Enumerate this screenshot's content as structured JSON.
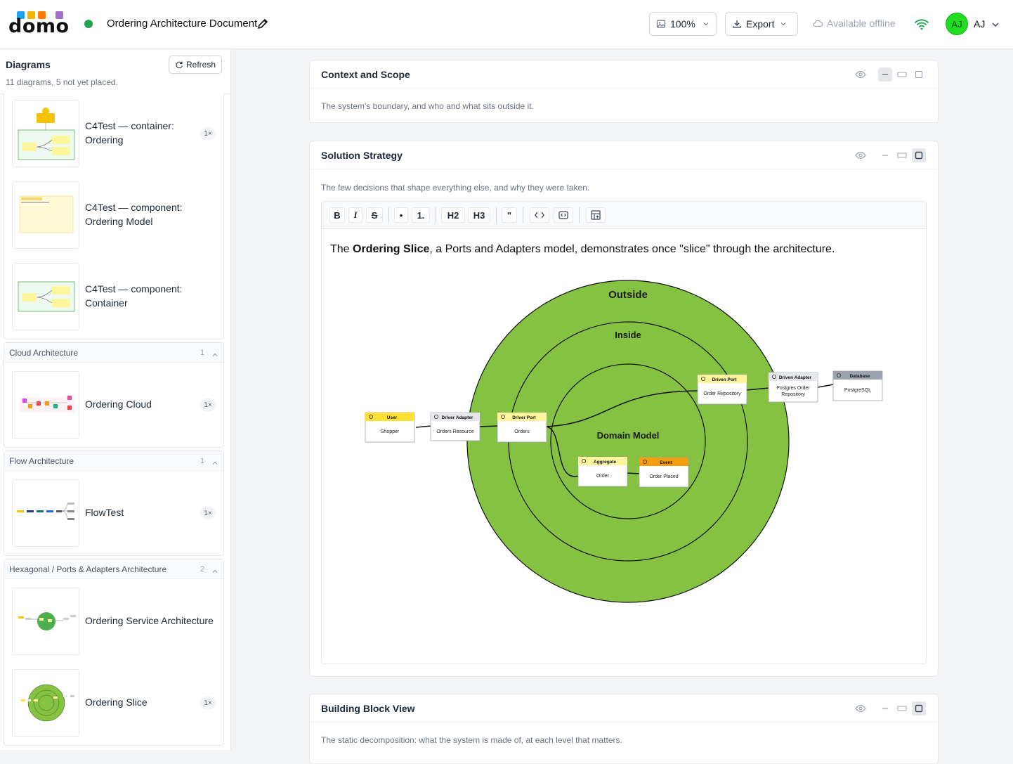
{
  "header": {
    "logo_text": "domo",
    "logo_colors": [
      "#1da1f2",
      "#f4b400",
      "#ff7a00",
      "#a46fc9"
    ],
    "status_color": "#22a350",
    "document_title": "Ordering Architecture Document",
    "edit_icon": "pencil-icon",
    "zoom_label": "100%",
    "export_label": "Export",
    "offline_label": "Available offline",
    "wifi_icon": "wifi-icon",
    "avatar_initials": "AJ",
    "user_label": "AJ"
  },
  "sidebar": {
    "title": "Diagrams",
    "subtitle": "11 diagrams, 5 not yet placed.",
    "refresh_label": "Refresh",
    "top_items": [
      {
        "label_line1": "C4Test — container:",
        "label_line2": "Ordering",
        "badge": "1×"
      },
      {
        "label_line1": "C4Test — component:",
        "label_line2": "Ordering Model"
      },
      {
        "label_line1": "C4Test — component:",
        "label_line2": "Container"
      }
    ],
    "groups": [
      {
        "title": "Cloud Architecture",
        "count": "1",
        "items": [
          {
            "label": "Ordering Cloud",
            "badge": "1×"
          }
        ]
      },
      {
        "title": "Flow Architecture",
        "count": "1",
        "items": [
          {
            "label": "FlowTest",
            "badge": "1×"
          }
        ]
      },
      {
        "title": "Hexagonal / Ports & Adapters Architecture",
        "count": "2",
        "items": [
          {
            "label": "Ordering Service Architecture"
          },
          {
            "label": "Ordering Slice",
            "badge": "1×"
          }
        ]
      }
    ]
  },
  "sections": [
    {
      "title": "Context and Scope",
      "description": "The system's boundary, and who and what sits outside it."
    },
    {
      "title": "Solution Strategy",
      "description": "The few decisions that shape everything else, and why they were taken."
    },
    {
      "title": "Building Block View",
      "description": "The static decomposition: what the system is made of, at each level that matters."
    }
  ],
  "editor": {
    "toolbar": [
      "B",
      "I",
      "S",
      "•",
      "1.",
      "H2",
      "H3",
      "\"",
      "<>",
      "{}",
      "table"
    ],
    "text_before": "The ",
    "text_bold": "Ordering Slice",
    "text_after": ", a Ports and Adapters model, demonstrates once \"slice\" through the architecture."
  },
  "diagram": {
    "ring_labels": {
      "outside": "Outside",
      "inside": "Inside",
      "domain": "Domain Model"
    },
    "ring_color": "#85c241",
    "nodes": [
      {
        "type": "User",
        "name": "Shopper",
        "color": "#ffe033"
      },
      {
        "type": "Driver Adapter",
        "name": "Orders Resource",
        "color": "#e5e7eb"
      },
      {
        "type": "Driver Port",
        "name": "Orders",
        "color": "#fff59d"
      },
      {
        "type": "Driven Port",
        "name": "Order Repository",
        "color": "#fff59d"
      },
      {
        "type": "Driven Adapter",
        "name": "Postgres Order Repository",
        "color": "#e5e7eb"
      },
      {
        "type": "Database",
        "name": "PostgreSQL",
        "color": "#9ca3af"
      },
      {
        "type": "Aggregate",
        "name": "Order",
        "color": "#fff59d"
      },
      {
        "type": "Event",
        "name": "Order Placed",
        "color": "#f59e0b"
      }
    ]
  }
}
